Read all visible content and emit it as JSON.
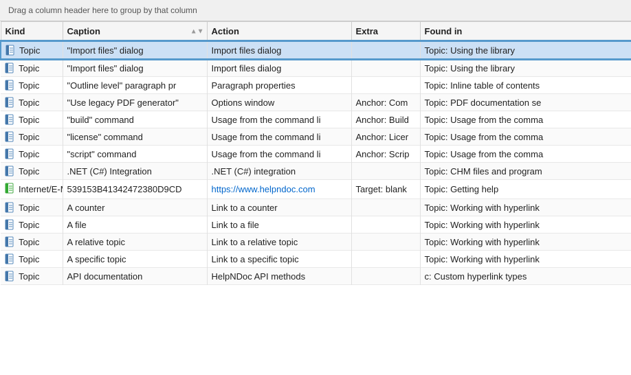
{
  "drag_header": "Drag a column header here to group by that column",
  "columns": [
    {
      "key": "kind",
      "label": "Kind"
    },
    {
      "key": "caption",
      "label": "Caption",
      "sortable": true
    },
    {
      "key": "action",
      "label": "Action"
    },
    {
      "key": "extra",
      "label": "Extra"
    },
    {
      "key": "found_in",
      "label": "Found in"
    }
  ],
  "rows": [
    {
      "kind": "Topic",
      "icon": "topic",
      "caption": "\"Import files\" dialog",
      "action": "Import files dialog",
      "extra": "",
      "found_in": "Topic: Using the library",
      "selected": true
    },
    {
      "kind": "Topic",
      "icon": "topic",
      "caption": "\"Import files\" dialog",
      "action": "Import files dialog",
      "extra": "",
      "found_in": "Topic: Using the library",
      "selected": false
    },
    {
      "kind": "Topic",
      "icon": "topic",
      "caption": "\"Outline level\" paragraph pr",
      "action": "Paragraph properties",
      "extra": "",
      "found_in": "Topic: Inline table of contents",
      "selected": false
    },
    {
      "kind": "Topic",
      "icon": "topic",
      "caption": "\"Use legacy PDF generator\"",
      "action": "Options window",
      "extra": "Anchor: Com",
      "found_in": "Topic: PDF documentation se",
      "selected": false
    },
    {
      "kind": "Topic",
      "icon": "topic",
      "caption": "\"build\" command",
      "action": "Usage from the command li",
      "extra": "Anchor: Build",
      "found_in": "Topic: Usage from the comma",
      "selected": false
    },
    {
      "kind": "Topic",
      "icon": "topic",
      "caption": "\"license\" command",
      "action": "Usage from the command li",
      "extra": "Anchor: Licer",
      "found_in": "Topic: Usage from the comma",
      "selected": false
    },
    {
      "kind": "Topic",
      "icon": "topic",
      "caption": "\"script\" command",
      "action": "Usage from the command li",
      "extra": "Anchor: Scrip",
      "found_in": "Topic: Usage from the comma",
      "selected": false
    },
    {
      "kind": "Topic",
      "icon": "topic",
      "caption": ".NET (C#) Integration",
      "action": ".NET (C#) integration",
      "extra": "",
      "found_in": "Topic: CHM files and program",
      "selected": false
    },
    {
      "kind": "Internet/E-M",
      "icon": "internet",
      "caption": "539153B41342472380D9CD",
      "action": "https://www.helpndoc.com",
      "extra": "Target: blank",
      "found_in": "Topic: Getting help",
      "selected": false
    },
    {
      "kind": "Topic",
      "icon": "topic",
      "caption": "A counter",
      "action": "Link to a counter",
      "extra": "",
      "found_in": "Topic: Working with hyperlink",
      "selected": false
    },
    {
      "kind": "Topic",
      "icon": "topic",
      "caption": "A file",
      "action": "Link to a file",
      "extra": "",
      "found_in": "Topic: Working with hyperlink",
      "selected": false
    },
    {
      "kind": "Topic",
      "icon": "topic",
      "caption": "A relative topic",
      "action": "Link to a relative topic",
      "extra": "",
      "found_in": "Topic: Working with hyperlink",
      "selected": false
    },
    {
      "kind": "Topic",
      "icon": "topic",
      "caption": "A specific topic",
      "action": "Link to a specific topic",
      "extra": "",
      "found_in": "Topic: Working with hyperlink",
      "selected": false
    },
    {
      "kind": "Topic",
      "icon": "topic",
      "caption": "API documentation",
      "action": "HelpNDoc API methods",
      "extra": "",
      "found_in": "c: Custom hyperlink types",
      "selected": false
    }
  ]
}
